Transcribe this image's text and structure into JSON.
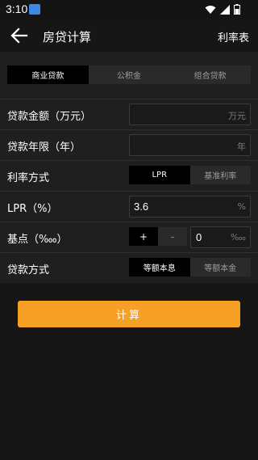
{
  "status_bar": {
    "time": "3:10"
  },
  "app_bar": {
    "title": "房贷计算",
    "rate_table": "利率表"
  },
  "loan_type_tabs": [
    {
      "label": "商业贷款",
      "active": true
    },
    {
      "label": "公积金",
      "active": false
    },
    {
      "label": "组合贷款",
      "active": false
    }
  ],
  "form": {
    "amount": {
      "label": "贷款金额（万元）",
      "value": "",
      "placeholder": "万元"
    },
    "years": {
      "label": "贷款年限（年）",
      "value": "",
      "placeholder": "年"
    },
    "rate_mode": {
      "label": "利率方式",
      "options": [
        "LPR",
        "基准利率"
      ],
      "selected": "LPR"
    },
    "lpr": {
      "label": "LPR（%）",
      "value": "3.6",
      "unit": "%"
    },
    "basis_points": {
      "label": "基点（‱）",
      "plus": "+",
      "minus": "-",
      "value": "0",
      "unit": "‱"
    },
    "repay_mode": {
      "label": "贷款方式",
      "options": [
        "等额本息",
        "等额本金"
      ],
      "selected": "等额本息"
    }
  },
  "calc_button": "计算",
  "colors": {
    "accent": "#f6a126",
    "background": "#161616",
    "panel": "#1f1f1f"
  }
}
